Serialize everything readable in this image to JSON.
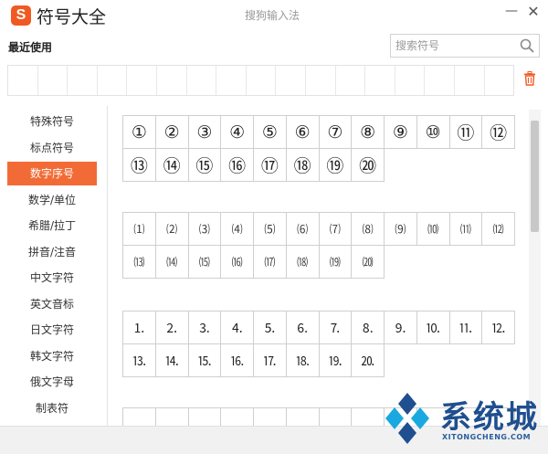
{
  "titlebar": {
    "logo_letter": "S",
    "title": "符号大全",
    "ime_name": "搜狗输入法",
    "minimize": "—",
    "close": "✕"
  },
  "recent": {
    "label": "最近使用",
    "search_placeholder": "搜索符号"
  },
  "sidebar": {
    "items": [
      "特殊符号",
      "标点符号",
      "数字序号",
      "数学/单位",
      "希腊/拉丁",
      "拼音/注音",
      "中文字符",
      "英文音标",
      "日文字符",
      "韩文字符",
      "俄文字母",
      "制表符"
    ],
    "active_index": 2
  },
  "grids": {
    "circled": [
      "①",
      "②",
      "③",
      "④",
      "⑤",
      "⑥",
      "⑦",
      "⑧",
      "⑨",
      "⑩",
      "⑪",
      "⑫",
      "⑬",
      "⑭",
      "⑮",
      "⑯",
      "⑰",
      "⑱",
      "⑲",
      "⑳"
    ],
    "parenthesized": [
      "⑴",
      "⑵",
      "⑶",
      "⑷",
      "⑸",
      "⑹",
      "⑺",
      "⑻",
      "⑼",
      "⑽",
      "⑾",
      "⑿",
      "⒀",
      "⒁",
      "⒂",
      "⒃",
      "⒄",
      "⒅",
      "⒆",
      "⒇"
    ],
    "period": [
      "⒈",
      "⒉",
      "⒊",
      "⒋",
      "⒌",
      "⒍",
      "⒎",
      "⒏",
      "⒐",
      "⒑",
      "⒒",
      "⒓",
      "⒔",
      "⒕",
      "⒖",
      "⒗",
      "⒘",
      "⒙",
      "⒚",
      "⒛"
    ]
  },
  "colors": {
    "accent": "#f26b36",
    "logo": "#f05a22",
    "watermark_blue": "#1f4f8f",
    "watermark_cyan": "#19a9e0"
  },
  "watermark": {
    "text": "系统城",
    "sub": "XITONGCHENG.COM"
  }
}
